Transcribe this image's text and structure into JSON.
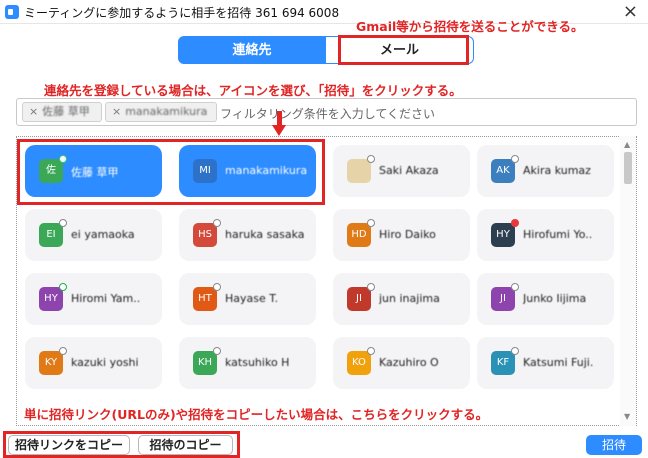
{
  "window": {
    "title": "ミーティングに参加するように相手を招待 361 694 6008",
    "close": "×"
  },
  "tabs": [
    {
      "label": "連絡先"
    },
    {
      "label": "メール"
    }
  ],
  "annotations": {
    "gmail": "Gmail等から招待を送ることができる。",
    "contacts": "連絡先を登録している場合は、アイコンを選び、「招待」をクリックする。",
    "copy": "単に招待リンク(URLのみ)や招待をコピーしたい場合は、こちらをクリックする。"
  },
  "filter": {
    "chips": [
      {
        "x": "×",
        "label": "佐藤 草甲"
      },
      {
        "x": "×",
        "label": "manakamikura"
      }
    ],
    "placeholder": "フィルタリング条件を入力してください"
  },
  "contacts": [
    {
      "initials": "佐",
      "color": "#3aa856",
      "name": "佐藤 草甲",
      "status": "green",
      "selected": true
    },
    {
      "initials": "MI",
      "color": "#2d72c8",
      "name": "manakamikura",
      "status": "none",
      "selected": true
    },
    {
      "initials": "",
      "color": "#e7d3a8",
      "name": "Saki Akaza",
      "status": "gray",
      "selected": false
    },
    {
      "initials": "AK",
      "color": "#3b7fbf",
      "name": "Akira kumaz",
      "status": "gray",
      "selected": false
    },
    {
      "initials": "EI",
      "color": "#3aa856",
      "name": "ei yamaoka",
      "status": "gray",
      "selected": false
    },
    {
      "initials": "HS",
      "color": "#d34a3a",
      "name": "haruka sasaka",
      "status": "gray",
      "selected": false
    },
    {
      "initials": "HD",
      "color": "#e07a16",
      "name": "Hiro Daiko",
      "status": "gray",
      "selected": false
    },
    {
      "initials": "HY",
      "color": "#2c3e50",
      "name": "Hirofumi Yo..",
      "status": "red",
      "selected": false
    },
    {
      "initials": "HY",
      "color": "#8e44ad",
      "name": "Hiromi Yam..",
      "status": "green",
      "selected": false
    },
    {
      "initials": "HT",
      "color": "#e05a16",
      "name": "Hayase T.",
      "status": "gray",
      "selected": false
    },
    {
      "initials": "JI",
      "color": "#c0392b",
      "name": "jun inajima",
      "status": "gray",
      "selected": false
    },
    {
      "initials": "JI",
      "color": "#8e44ad",
      "name": "Junko Iijima",
      "status": "gray",
      "selected": false
    },
    {
      "initials": "KY",
      "color": "#e07a16",
      "name": "kazuki yoshi",
      "status": "gray",
      "selected": false
    },
    {
      "initials": "KH",
      "color": "#3aa856",
      "name": "katsuhiko H",
      "status": "gray",
      "selected": false
    },
    {
      "initials": "KO",
      "color": "#f1a10c",
      "name": "Kazuhiro O",
      "status": "gray",
      "selected": false
    },
    {
      "initials": "KF",
      "color": "#2a92b5",
      "name": "Katsumi Fuji.",
      "status": "gray",
      "selected": false
    }
  ],
  "scrollbar": {
    "up": "▲",
    "down": "▼"
  },
  "buttons": {
    "copy_link": "招待リンクをコピー",
    "copy_invite": "招待のコピー",
    "invite": "招待"
  }
}
